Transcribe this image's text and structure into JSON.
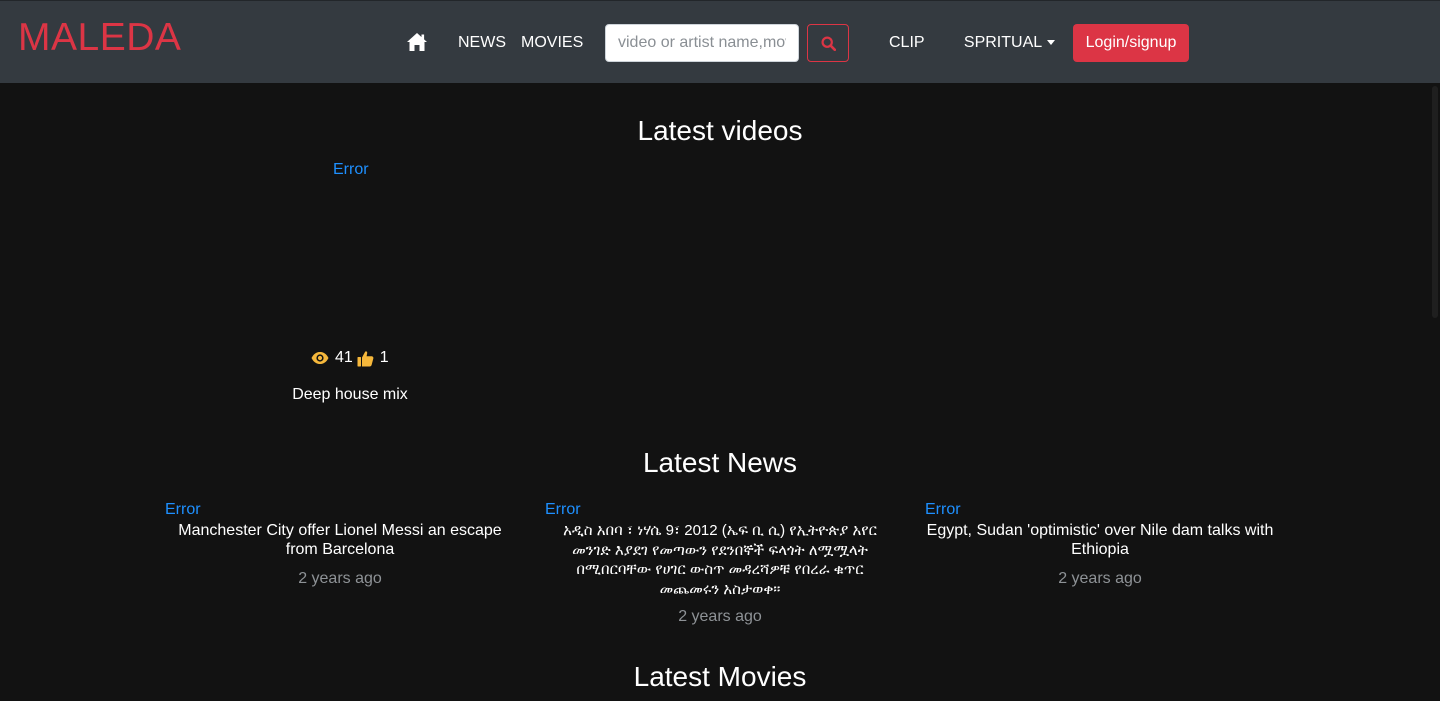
{
  "brand": "MALEDA",
  "nav": {
    "home_icon": "home-icon",
    "news": "NEWS",
    "movies": "MOVIES",
    "search_placeholder": "video or artist name,movie",
    "search_icon": "search-icon",
    "clip": "CLIP",
    "spiritual": " SPRITUAL",
    "login": "Login/signup"
  },
  "colors": {
    "accent": "#dc3545",
    "navbar": "#343a40",
    "background": "#121212",
    "link": "#1e90ff",
    "icon_yellow": "#f5b73b",
    "muted": "#8e9296"
  },
  "videos": {
    "title": "Latest videos",
    "items": [
      {
        "error": "Error",
        "views": "41",
        "likes": "1",
        "title": "Deep house mix",
        "views_icon": "eye-icon",
        "likes_icon": "thumbs-up-icon"
      }
    ]
  },
  "news": {
    "title": "Latest News",
    "items": [
      {
        "error": "Error",
        "title": "Manchester City offer Lionel Messi an escape from Barcelona",
        "time": "2 years ago"
      },
      {
        "error": "Error",
        "title": "አዲስ አበባ ፣ ነሃሴ 9፣ 2012 (ኤፍ ቢ ሲ) የኢትዮጵያ አየር መንገድ እያደገ የመጣውን የደንበኞች ፍላጎት ለሟሟላት በሚበርባቸው የሀገር ውስጥ መዳረሻዎቹ የበረራ ቁጥር መጨመሩን አስታወቀ።",
        "time": "2 years ago"
      },
      {
        "error": "Error",
        "title": "Egypt, Sudan 'optimistic' over Nile dam talks with Ethiopia",
        "time": "2 years ago"
      }
    ]
  },
  "movies": {
    "title": "Latest Movies"
  }
}
